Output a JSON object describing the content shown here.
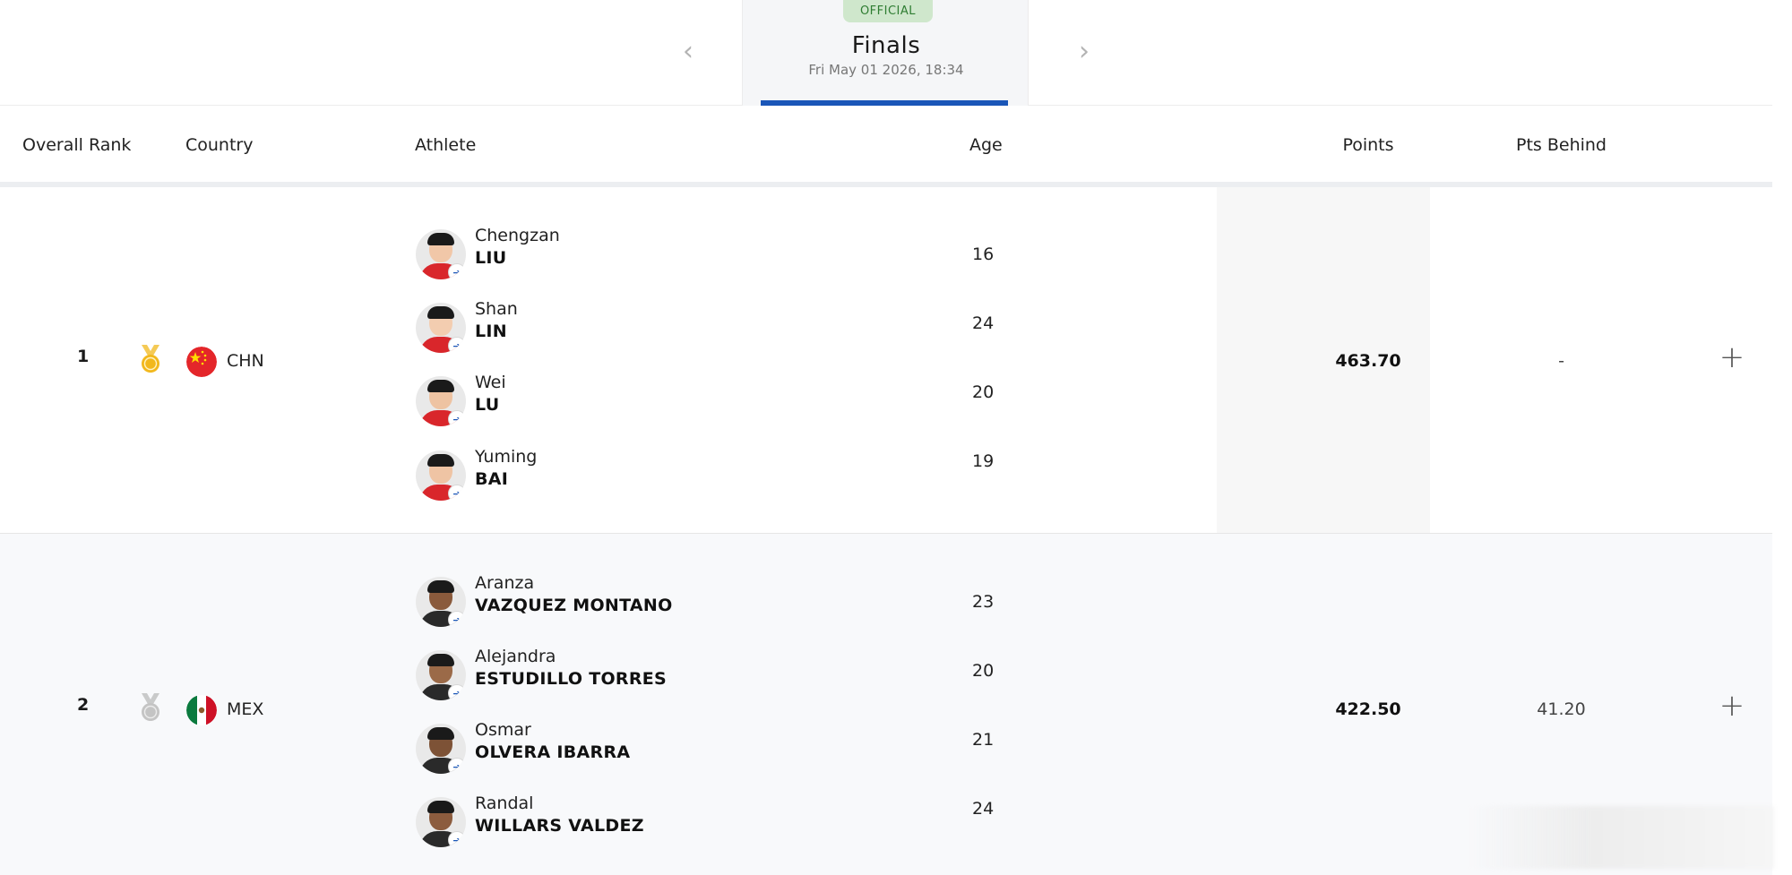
{
  "phase": {
    "status": "OFFICIAL",
    "title": "Finals",
    "datetime": "Fri May 01 2026, 18:34",
    "prev_arrow": "‹",
    "next_arrow": "›"
  },
  "table": {
    "headers": {
      "rank": "Overall Rank",
      "country": "Country",
      "athlete": "Athlete",
      "age": "Age",
      "points": "Points",
      "behind": "Pts Behind"
    },
    "rows": [
      {
        "rank": "1",
        "medal": "gold-medal-icon",
        "country_code": "CHN",
        "flag": "china-flag-icon",
        "points": "463.70",
        "pts_behind": "-",
        "expand": "+",
        "athletes": [
          {
            "first": "Chengzan",
            "last": "LIU",
            "age": "16"
          },
          {
            "first": "Shan",
            "last": "LIN",
            "age": "24"
          },
          {
            "first": "Wei",
            "last": "LU",
            "age": "20"
          },
          {
            "first": "Yuming",
            "last": "BAI",
            "age": "19"
          }
        ]
      },
      {
        "rank": "2",
        "medal": "silver-medal-icon",
        "country_code": "MEX",
        "flag": "mexico-flag-icon",
        "points": "422.50",
        "pts_behind": "41.20",
        "expand": "+",
        "athletes": [
          {
            "first": "Aranza",
            "last": "VAZQUEZ MONTANO",
            "age": "23"
          },
          {
            "first": "Alejandra",
            "last": "ESTUDILLO TORRES",
            "age": "20"
          },
          {
            "first": "Osmar",
            "last": "OLVERA IBARRA",
            "age": "21"
          },
          {
            "first": "Randal",
            "last": "WILLARS VALDEZ",
            "age": "24"
          }
        ]
      }
    ]
  },
  "colors": {
    "accent": "#1a56b8",
    "official_bg": "#cfe7cc",
    "official_text": "#2f7d32",
    "gold": "#f2b81c",
    "silver": "#b9b9b9",
    "china_red": "#e4262a",
    "china_star": "#ffde00",
    "mexico_green": "#0b7a3e",
    "mexico_red": "#ce1126"
  }
}
